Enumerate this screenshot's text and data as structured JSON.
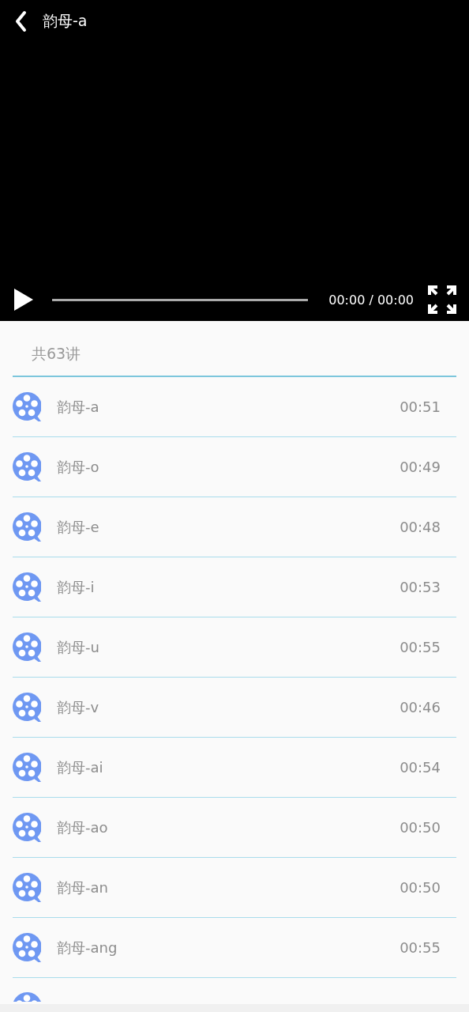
{
  "player": {
    "title": "韵母-a",
    "progress": {
      "level": 0
    },
    "time": "00:00 / 00:00"
  },
  "playlist": {
    "count": "共63讲",
    "items": [
      {
        "title": "韵母-a",
        "duration": "00:51"
      },
      {
        "title": "韵母-o",
        "duration": "00:49"
      },
      {
        "title": "韵母-e",
        "duration": "00:48"
      },
      {
        "title": "韵母-i",
        "duration": "00:53"
      },
      {
        "title": "韵母-u",
        "duration": "00:55"
      },
      {
        "title": "韵母-v",
        "duration": "00:46"
      },
      {
        "title": "韵母-ai",
        "duration": "00:54"
      },
      {
        "title": "韵母-ao",
        "duration": "00:50"
      },
      {
        "title": "韵母-an",
        "duration": "00:50"
      },
      {
        "title": "韵母-ang",
        "duration": "00:55"
      }
    ]
  }
}
